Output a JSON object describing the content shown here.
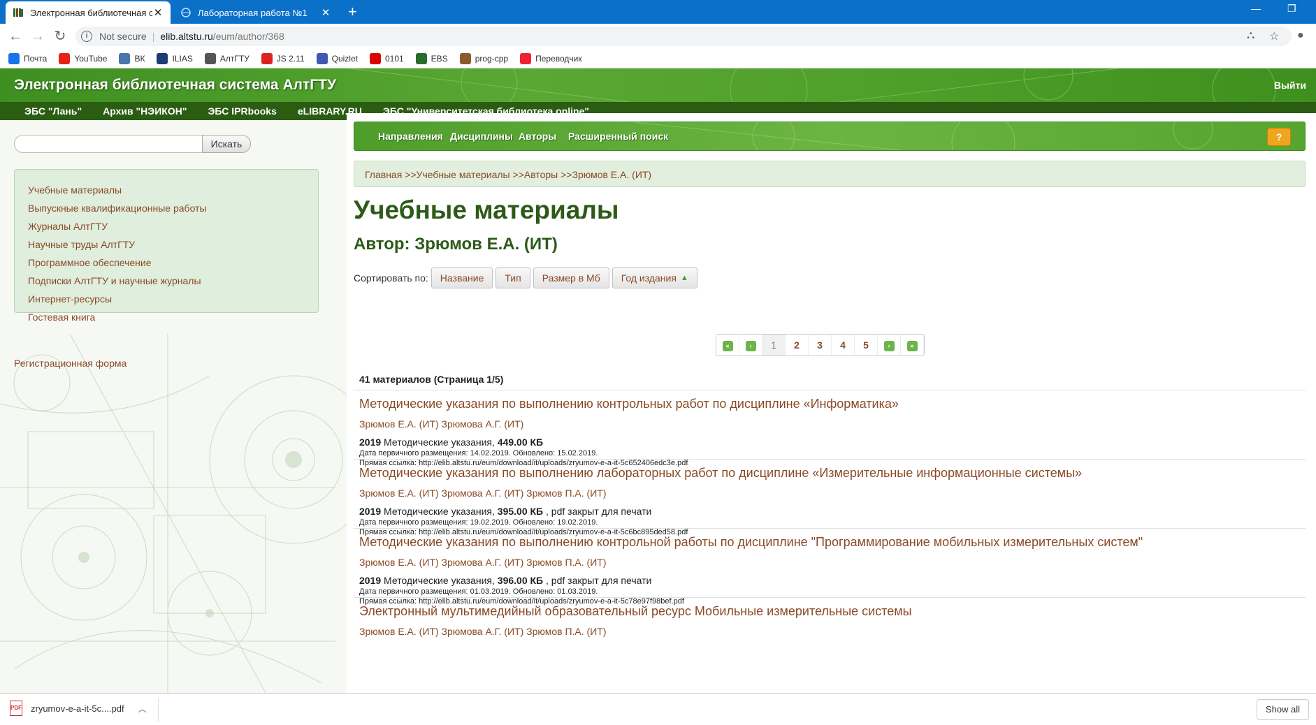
{
  "browser": {
    "tabs": [
      {
        "title": "Электронная библиотечная сис",
        "active": true
      },
      {
        "title": "Лабораторная работа №1",
        "active": false
      }
    ],
    "new_tab": "+",
    "address": {
      "security": "Not secure",
      "host": "elib.altstu.ru",
      "path": "/eum/author/368"
    },
    "bookmarks": [
      {
        "label": "Почта",
        "icon": "mail-icon",
        "color": "#1a73e8"
      },
      {
        "label": "YouTube",
        "icon": "youtube-icon",
        "color": "#e62117"
      },
      {
        "label": "ВК",
        "icon": "vk-icon",
        "color": "#4a76a8"
      },
      {
        "label": "ILIAS",
        "icon": "ilias-icon",
        "color": "#1c3d73"
      },
      {
        "label": "АлтГТУ",
        "icon": "altstu-icon",
        "color": "#555555"
      },
      {
        "label": "JS 2.11",
        "icon": "js-icon",
        "color": "#d22"
      },
      {
        "label": "Quizlet",
        "icon": "quizlet-icon",
        "color": "#4257b2"
      },
      {
        "label": "0101",
        "icon": "arrow-icon",
        "color": "#d00"
      },
      {
        "label": "EBS",
        "icon": "books-icon",
        "color": "#2a6b2a"
      },
      {
        "label": "prog-cpp",
        "icon": "prog-icon",
        "color": "#8b5a2b"
      },
      {
        "label": "Переводчик",
        "icon": "translate-icon",
        "color": "#e23"
      }
    ]
  },
  "site": {
    "title": "Электронная библиотечная система АлтГТУ",
    "logout": "Выйти",
    "ebs_links": [
      "ЭБС \"Лань\"",
      "Архив \"НЭИКОН\"",
      "ЭБС IPRbooks",
      "eLIBRARY.RU",
      "ЭБС \"Университетская библиотека online\""
    ]
  },
  "search": {
    "button": "Искать",
    "value": ""
  },
  "sidebar": {
    "items": [
      "Учебные материалы",
      "Выпускные квалификационные работы",
      "Журналы АлтГТУ",
      "Научные труды АлтГТУ",
      "Программное обеспечение",
      "Подписки АлтГТУ и научные журналы",
      "Интернет-ресурсы",
      "Гостевая книга"
    ],
    "registration": "Регистрационная форма"
  },
  "subnav": {
    "items": [
      "Направления",
      "Дисциплины",
      "Авторы",
      "Расширенный поиск"
    ],
    "help": "?"
  },
  "breadcrumbs": [
    "Главная",
    "Учебные материалы",
    "Авторы",
    "Зрюмов Е.А. (ИТ)"
  ],
  "breadcrumb_sep": ">>",
  "heading": "Учебные материалы",
  "author_heading": "Автор: Зрюмов Е.А. (ИТ)",
  "sort": {
    "label": "Сортировать по:",
    "options": [
      "Название",
      "Тип",
      "Размер в Мб",
      "Год издания"
    ],
    "active": "Год издания"
  },
  "pager": {
    "pages": [
      "1",
      "2",
      "3",
      "4",
      "5"
    ],
    "current": "1"
  },
  "count_text": "41 материалов (Страница 1/5)",
  "materials": [
    {
      "title": "Методические указания по выполнению контрольных работ по дисциплине «Информатика»",
      "authors": "Зрюмов Е.А. (ИТ) Зрюмова А.Г. (ИТ)",
      "year": "2019",
      "type": "Методические указания,",
      "size": "449.00 КБ",
      "note": "",
      "dates": "Дата первичного размещения: 14.02.2019. Обновлено: 15.02.2019.",
      "link": "Прямая ссылка: http://elib.altstu.ru/eum/download/it/uploads/zryumov-e-a-it-5c652406edc3e.pdf"
    },
    {
      "title": "Методические указания по выполнению лабораторных работ по дисциплине «Измерительные информационные системы»",
      "authors": "Зрюмов Е.А. (ИТ) Зрюмова А.Г. (ИТ) Зрюмов П.А. (ИТ)",
      "year": "2019",
      "type": "Методические указания,",
      "size": "395.00 КБ",
      "note": ", pdf закрыт для печати",
      "dates": "Дата первичного размещения: 19.02.2019. Обновлено: 19.02.2019.",
      "link": "Прямая ссылка: http://elib.altstu.ru/eum/download/it/uploads/zryumov-e-a-it-5c6bc895ded58.pdf"
    },
    {
      "title": "Методические указания по выполнению контрольной работы по дисциплине \"Программирование мобильных измерительных систем\"",
      "authors": "Зрюмов Е.А. (ИТ) Зрюмова А.Г. (ИТ) Зрюмов П.А. (ИТ)",
      "year": "2019",
      "type": "Методические указания,",
      "size": "396.00 КБ",
      "note": ", pdf закрыт для печати",
      "dates": "Дата первичного размещения: 01.03.2019. Обновлено: 01.03.2019.",
      "link": "Прямая ссылка: http://elib.altstu.ru/eum/download/it/uploads/zryumov-e-a-it-5c78e97f98bef.pdf"
    },
    {
      "title": "Электронный мультимедийный образовательный ресурс Мобильные измерительные системы",
      "authors": "Зрюмов Е.А. (ИТ) Зрюмова А.Г. (ИТ) Зрюмов П.А. (ИТ)",
      "year": "",
      "type": "",
      "size": "",
      "note": "",
      "dates": "",
      "link": ""
    }
  ],
  "downloads": {
    "file": "zryumov-e-a-it-5c....pdf",
    "show_all": "Show all"
  }
}
